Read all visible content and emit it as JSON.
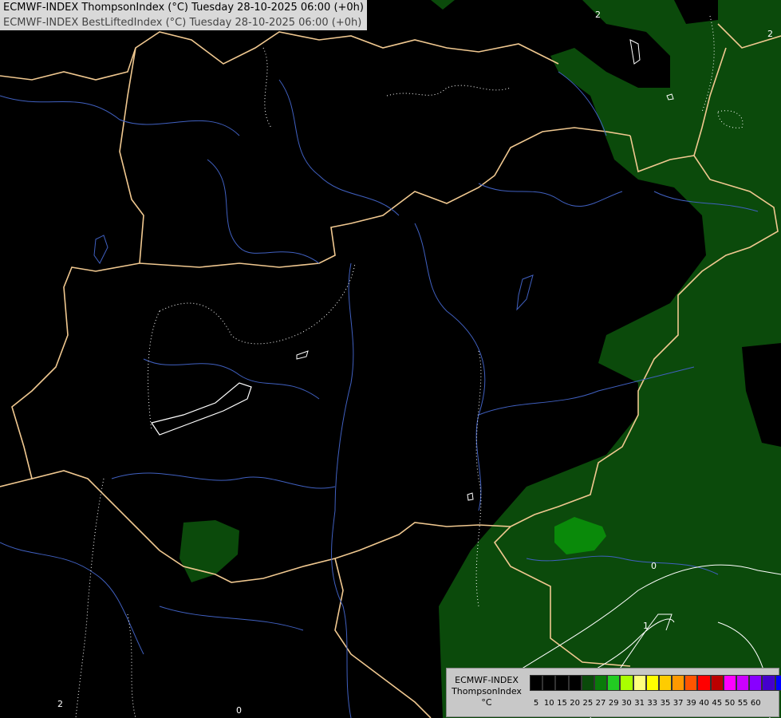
{
  "header": {
    "line1": "ECMWF-INDEX ThompsonIndex (°C) Tuesday 28-10-2025 06:00 (+0h)",
    "line2": "ECMWF-INDEX BestLiftedIndex (°C) Tuesday 28-10-2025 06:00 (+0h)"
  },
  "legend": {
    "title_line1": "ECMWF-INDEX",
    "title_line2": "ThompsonIndex",
    "title_line3": "°C",
    "swatches": [
      "#000000",
      "#000000",
      "#000000",
      "#000000",
      "#0a4a0a",
      "#0a7a0a",
      "#22cc22",
      "#aaff00",
      "#ffff80",
      "#ffff00",
      "#ffcc00",
      "#ff9900",
      "#ff5500",
      "#ff0000",
      "#bb0000",
      "#ff00ff",
      "#cc00ff",
      "#8800ff",
      "#4400cc",
      "#0000ff"
    ],
    "ticks": [
      "5",
      "10",
      "15",
      "20",
      "25",
      "27",
      "29",
      "30",
      "31",
      "33",
      "35",
      "37",
      "39",
      "40",
      "45",
      "50",
      "55",
      "60"
    ]
  },
  "contour_labels": {
    "top_right_a": "2",
    "top_right_b": "2",
    "bottom_0a": "0",
    "bottom_0b": "0",
    "bottom_1": "1",
    "bottom_left_2": "2"
  },
  "colors": {
    "background": "#000000",
    "green_dark": "#0b4a0b",
    "green_mid": "#0a8a0a",
    "border": "#f0c890",
    "river": "#4060c0"
  }
}
